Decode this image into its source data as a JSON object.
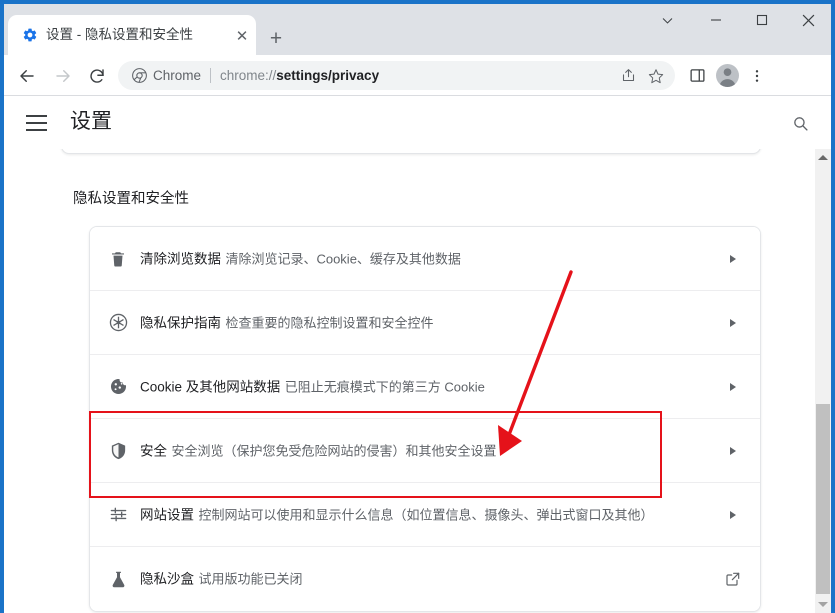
{
  "window": {
    "controls": [
      {
        "name": "tab-search",
        "glyph": "⌄"
      },
      {
        "name": "minimize",
        "glyph": "–"
      },
      {
        "name": "maximize",
        "glyph": "□"
      },
      {
        "name": "close",
        "glyph": "✕"
      }
    ]
  },
  "tab": {
    "title": "设置 - 隐私设置和安全性",
    "favicon": "settings-gear-icon",
    "close_glyph": "✕",
    "newtab_glyph": "+"
  },
  "toolbar": {
    "back": "back-arrow",
    "forward": "forward-arrow",
    "reload": "reload-arrow",
    "omnibox": {
      "chip_label": "Chrome",
      "url_scheme": "chrome://",
      "url_path": "settings/privacy",
      "share_icon": "share-icon",
      "bookmark_icon": "star-icon"
    },
    "side_panel_icon": "side-panel-icon",
    "profile_icon": "avatar-icon",
    "menu_icon": "three-dot-menu-icon"
  },
  "settings": {
    "menu_label": "hamburger-menu",
    "title": "设置",
    "search_icon": "search-icon"
  },
  "page": {
    "section_title": "隐私设置和安全性",
    "rows": [
      {
        "icon": "trash-icon",
        "title": "清除浏览数据",
        "subtitle": "清除浏览记录、Cookie、缓存及其他数据",
        "action": "chevron-right-icon"
      },
      {
        "icon": "privacy-guide-icon",
        "title": "隐私保护指南",
        "subtitle": "检查重要的隐私控制设置和安全控件",
        "action": "chevron-right-icon"
      },
      {
        "icon": "cookie-icon",
        "title": "Cookie 及其他网站数据",
        "subtitle": "已阻止无痕模式下的第三方 Cookie",
        "action": "chevron-right-icon"
      },
      {
        "icon": "shield-icon",
        "title": "安全",
        "subtitle": "安全浏览（保护您免受危险网站的侵害）和其他安全设置",
        "action": "chevron-right-icon"
      },
      {
        "icon": "tune-sliders-icon",
        "title": "网站设置",
        "subtitle": "控制网站可以使用和显示什么信息（如位置信息、摄像头、弹出式窗口及其他）",
        "action": "chevron-right-icon"
      },
      {
        "icon": "flask-icon",
        "title": "隐私沙盒",
        "subtitle": "试用版功能已关闭",
        "action": "external-link-icon"
      }
    ]
  },
  "annotations": {
    "highlight_color": "#e5121a",
    "highlight_target": "安全",
    "arrow_color": "#e5121a"
  },
  "scrollbar": {
    "up_arrow": "scroll-up-arrow",
    "down_arrow": "scroll-down-arrow",
    "thumb": "scroll-thumb"
  }
}
